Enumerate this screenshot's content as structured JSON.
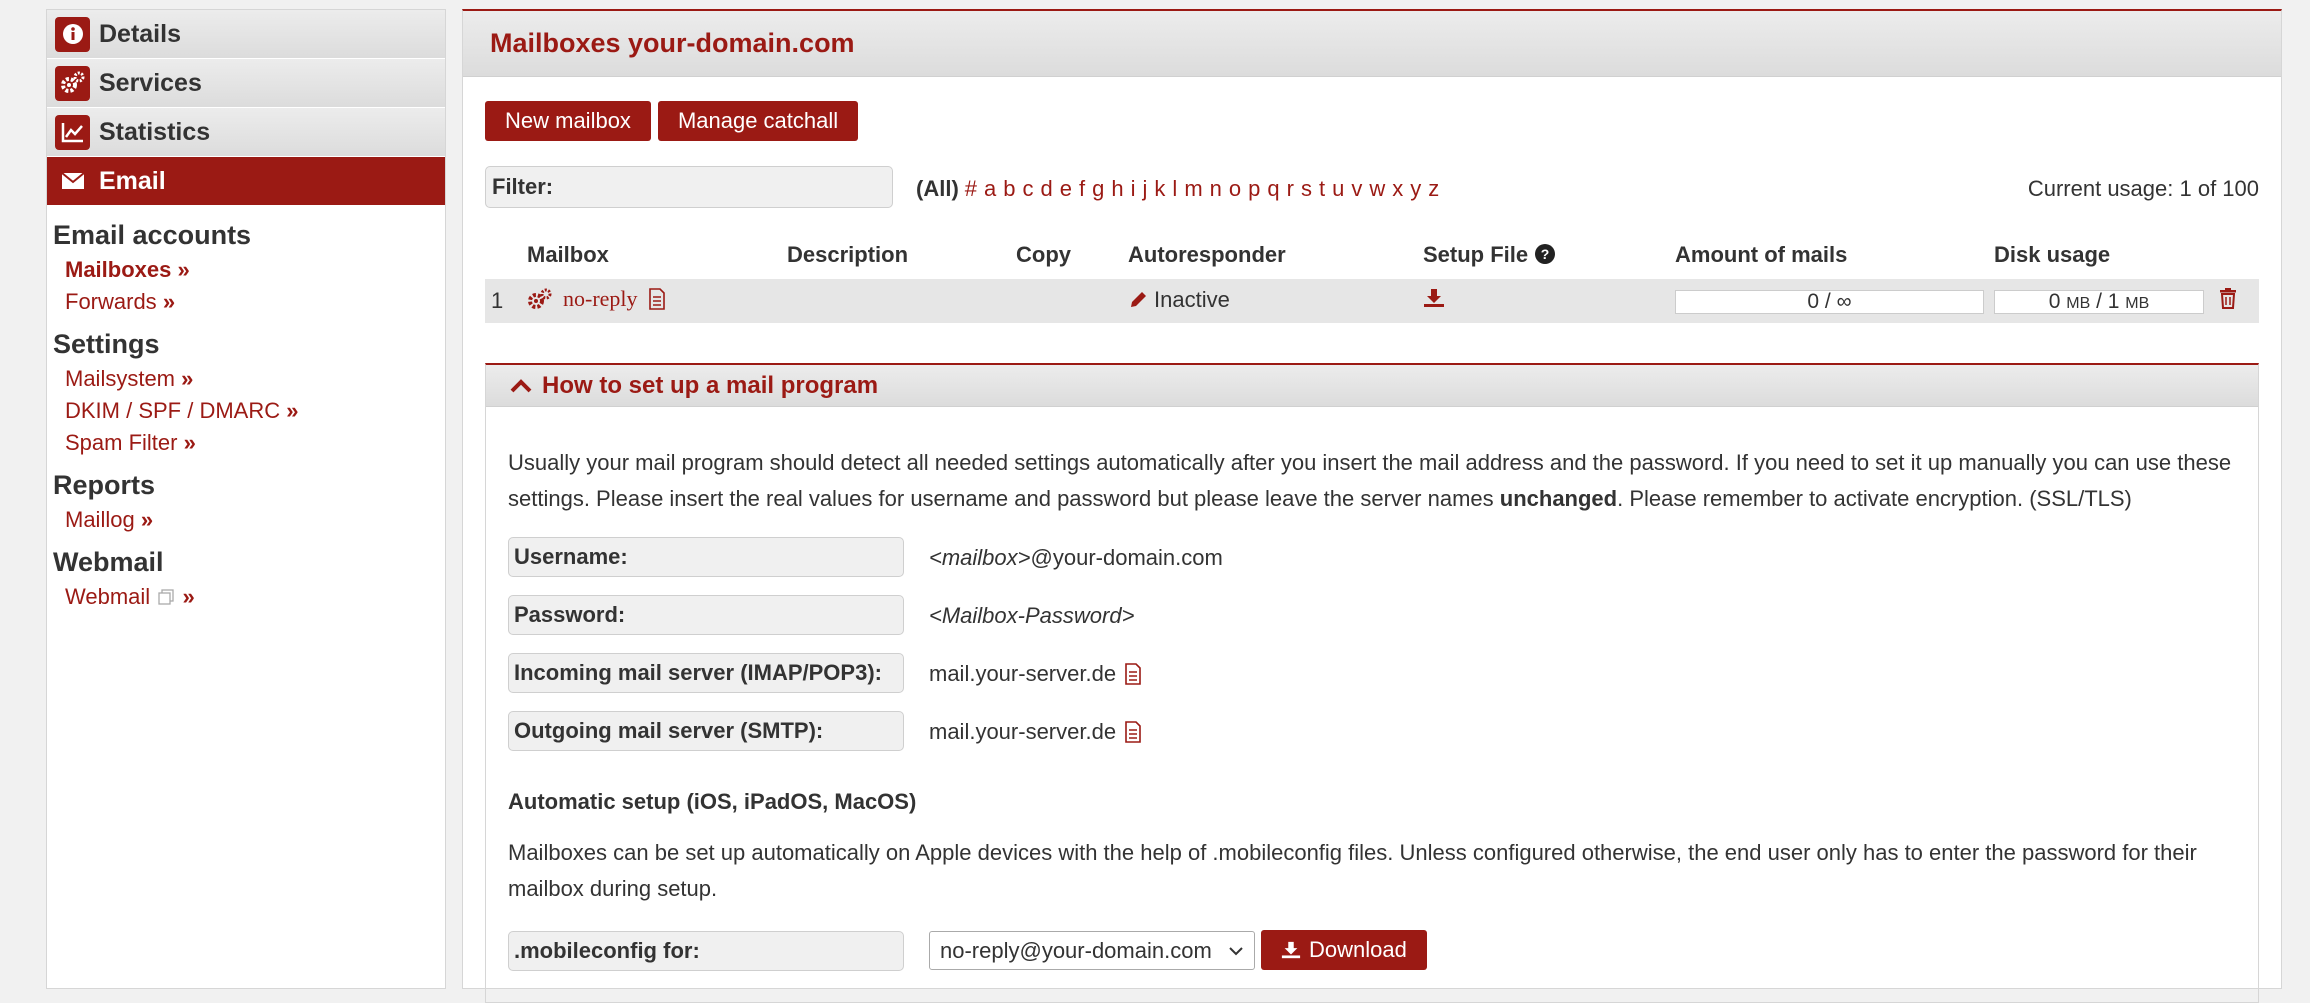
{
  "sidebar": {
    "tabs": [
      {
        "label": "Details",
        "icon": "info-icon"
      },
      {
        "label": "Services",
        "icon": "gears-icon"
      },
      {
        "label": "Statistics",
        "icon": "chart-icon"
      },
      {
        "label": "Email",
        "icon": "envelope-icon",
        "active": true
      }
    ],
    "sections": [
      {
        "title": "Email accounts",
        "links": [
          "Mailboxes",
          "Forwards"
        ]
      },
      {
        "title": "Settings",
        "links": [
          "Mailsystem",
          "DKIM / SPF / DMARC",
          "Spam Filter"
        ]
      },
      {
        "title": "Reports",
        "links": [
          "Maillog"
        ]
      },
      {
        "title": "Webmail",
        "links": [
          "Webmail"
        ]
      }
    ],
    "link_suffix": "»"
  },
  "main": {
    "title": "Mailboxes your-domain.com",
    "buttons": {
      "new_mailbox": "New mailbox",
      "manage_catchall": "Manage catchall"
    },
    "filter_label": "Filter:",
    "letters_all": "(All)",
    "letters": [
      "#",
      "a",
      "b",
      "c",
      "d",
      "e",
      "f",
      "g",
      "h",
      "i",
      "j",
      "k",
      "l",
      "m",
      "n",
      "o",
      "p",
      "q",
      "r",
      "s",
      "t",
      "u",
      "v",
      "w",
      "x",
      "y",
      "z"
    ],
    "usage": "Current usage: 1 of 100",
    "table": {
      "headers": {
        "mailbox": "Mailbox",
        "description": "Description",
        "copy": "Copy",
        "autoresponder": "Autoresponder",
        "setup_file": "Setup File",
        "amount": "Amount of mails",
        "disk": "Disk usage"
      },
      "row": {
        "index": "1",
        "mailbox": "no-reply",
        "autoresponder": "Inactive",
        "amount": "0 / ∞",
        "disk_used": "0",
        "disk_total": "1",
        "disk_unit": "MB"
      }
    },
    "howto": {
      "title": "How to set up a mail program",
      "intro_a": "Usually your mail program should detect all needed settings automatically after you insert the mail address and the password. If you need to set it up manually you can use these settings. Please insert the real values for username and password but please leave the server names ",
      "intro_bold": "unchanged",
      "intro_b": ". Please remember to activate encryption. (SSL/TLS)",
      "username_label": "Username:",
      "username_italic": "<mailbox>",
      "username_rest": "@your-domain.com",
      "password_label": "Password:",
      "password_value": "<Mailbox-Password>",
      "incoming_label": "Incoming mail server (IMAP/POP3):",
      "incoming_value": "mail.your-server.de",
      "outgoing_label": "Outgoing mail server (SMTP):",
      "outgoing_value": "mail.your-server.de",
      "auto_title": "Automatic setup (iOS, iPadOS, MacOS)",
      "auto_text": "Mailboxes can be set up automatically on Apple devices with the help of .mobileconfig files. Unless configured otherwise, the end user only has to enter the password for their mailbox during setup.",
      "mobileconfig_label": ".mobileconfig for:",
      "mobileconfig_selected": "no-reply@your-domain.com",
      "download_label": "Download"
    }
  },
  "colors": {
    "accent": "#9b1a14",
    "panel": "#dcdcdc"
  }
}
